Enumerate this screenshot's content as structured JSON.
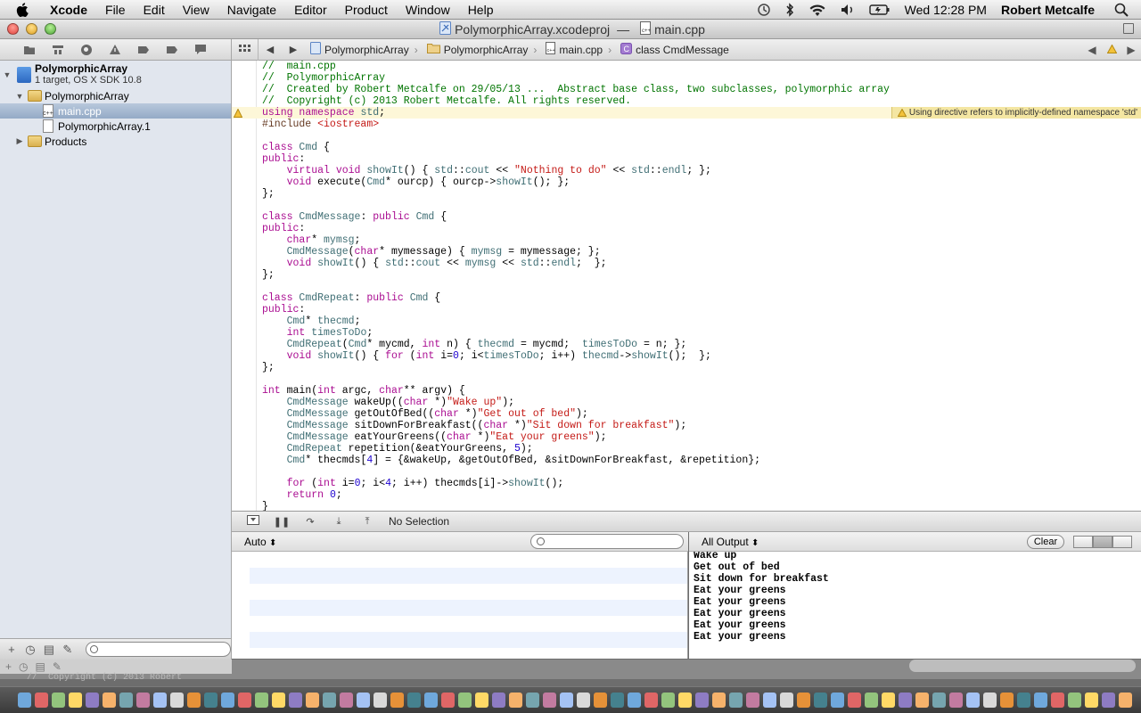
{
  "menubar": {
    "app_name": "Xcode",
    "items": [
      "File",
      "Edit",
      "View",
      "Navigate",
      "Editor",
      "Product",
      "Window",
      "Help"
    ],
    "clock": "Wed 12:28 PM",
    "user": "Robert Metcalfe"
  },
  "window": {
    "title_project": "PolymorphicArray.xcodeproj",
    "title_sep": "—",
    "title_file": "main.cpp"
  },
  "navigator": {
    "project_name": "PolymorphicArray",
    "project_sub": "1 target, OS X SDK 10.8",
    "group": "PolymorphicArray",
    "files": [
      "main.cpp",
      "PolymorphicArray.1"
    ],
    "products": "Products",
    "selected_file": "main.cpp"
  },
  "jumpbar": {
    "crumbs": [
      "PolymorphicArray",
      "PolymorphicArray",
      "main.cpp",
      "class CmdMessage"
    ]
  },
  "editor": {
    "warning_message": "Using directive refers to implicitly-defined namespace 'std'",
    "lines": [
      "//  main.cpp",
      "//  PolymorphicArray",
      "//  Created by Robert Metcalfe on 29/05/13 ...  Abstract base class, two subclasses, polymorphic array",
      "//  Copyright (c) 2013 Robert Metcalfe. All rights reserved.",
      "using namespace std;",
      "#include <iostream>",
      "",
      "class Cmd {",
      "public:",
      "    virtual void showIt() { std::cout << \"Nothing to do\" << std::endl; };",
      "    void execute(Cmd* ourcp) { ourcp->showIt(); };",
      "};",
      "",
      "class CmdMessage: public Cmd {",
      "public:",
      "    char* mymsg;",
      "    CmdMessage(char* mymessage) { mymsg = mymessage; };",
      "    void showIt() { std::cout << mymsg << std::endl;  };",
      "};",
      "",
      "class CmdRepeat: public Cmd {",
      "public:",
      "    Cmd* thecmd;",
      "    int timesToDo;",
      "    CmdRepeat(Cmd* mycmd, int n) { thecmd = mycmd;  timesToDo = n; };",
      "    void showIt() { for (int i=0; i<timesToDo; i++) thecmd->showIt();  };",
      "};",
      "",
      "int main(int argc, char** argv) {",
      "    CmdMessage wakeUp((char *)\"Wake up\");",
      "    CmdMessage getOutOfBed((char *)\"Get out of bed\");",
      "    CmdMessage sitDownForBreakfast((char *)\"Sit down for breakfast\");",
      "    CmdMessage eatYourGreens((char *)\"Eat your greens\");",
      "    CmdRepeat repetition(&eatYourGreens, 5);",
      "    Cmd* thecmds[4] = {&wakeUp, &getOutOfBed, &sitDownForBreakfast, &repetition};",
      "",
      "    for (int i=0; i<4; i++) thecmds[i]->showIt();",
      "    return 0;",
      "}"
    ]
  },
  "debugbar": {
    "selection": "No Selection"
  },
  "variables": {
    "scope": "Auto",
    "scope_arrow": "⬍"
  },
  "console": {
    "filter": "All Output",
    "clear_label": "Clear",
    "output": [
      "Wake up",
      "Get out of bed",
      "Sit down for breakfast",
      "Eat your greens",
      "Eat your greens",
      "Eat your greens",
      "Eat your greens",
      "Eat your greens"
    ]
  },
  "background_text": "//  Copyright (c) 2013 Robert",
  "colors": {
    "comment": "#007400",
    "keyword": "#aa0d91",
    "string": "#c41a16",
    "preprocessor": "#643820",
    "type": "#3f6e74",
    "selection": "#94aac6",
    "warning_bg": "#fdf7d8"
  }
}
